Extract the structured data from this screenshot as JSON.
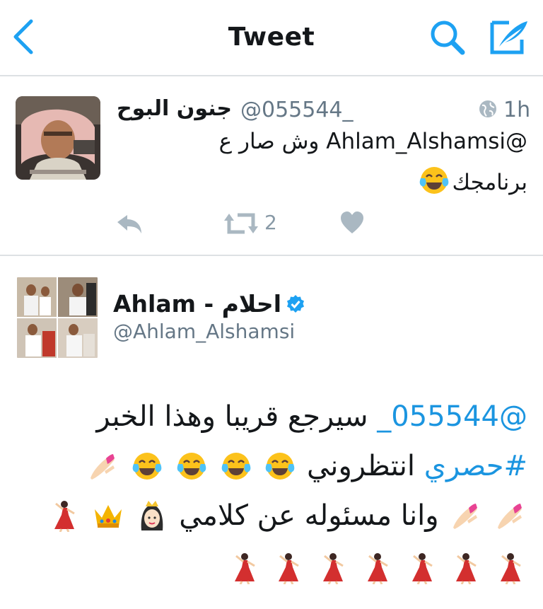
{
  "header": {
    "title": "Tweet",
    "back_icon": "chevron-left-icon",
    "search_icon": "search-icon",
    "compose_icon": "compose-quill-icon",
    "accent": "#1da1f2"
  },
  "reply_tweet": {
    "display_name": "جنون البوح",
    "handle": "@055544_",
    "time": "1h",
    "text_line1": "@Ahlam_Alshamsi وش صار ع",
    "text_line2": "برنامجك",
    "retweet_count": "2"
  },
  "main_tweet": {
    "display_name": "Ahlam - احلام",
    "handle": "@Ahlam_Alshamsi",
    "verified": true,
    "line1_mention": "@055544_",
    "line1_text": "سيرجع قريبا وهذا الخبر",
    "line2_hashtag": "#حصري",
    "line2_text": "انتظروني",
    "line3_text": "وانا مسئوله عن كلامي"
  }
}
